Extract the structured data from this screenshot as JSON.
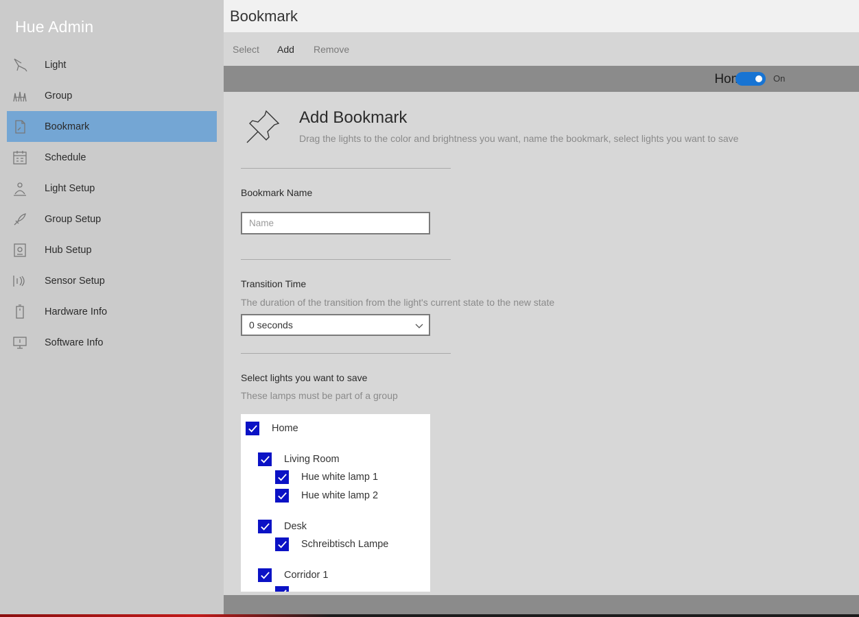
{
  "app": {
    "title": "Hue Admin"
  },
  "sidebar": {
    "active": "Bookmark",
    "items": [
      {
        "label": "Light",
        "icon": "lamp-icon"
      },
      {
        "label": "Group",
        "icon": "group-lamps-icon"
      },
      {
        "label": "Bookmark",
        "icon": "bookmark-document-icon"
      },
      {
        "label": "Schedule",
        "icon": "calendar-icon"
      },
      {
        "label": "Light Setup",
        "icon": "light-setup-icon"
      },
      {
        "label": "Group Setup",
        "icon": "group-setup-icon"
      },
      {
        "label": "Hub Setup",
        "icon": "hub-icon"
      },
      {
        "label": "Sensor Setup",
        "icon": "sensor-icon"
      },
      {
        "label": "Hardware Info",
        "icon": "hardware-icon"
      },
      {
        "label": "Software Info",
        "icon": "monitor-icon"
      }
    ]
  },
  "page": {
    "title": "Bookmark"
  },
  "commands": {
    "select": "Select",
    "add": "Add",
    "remove": "Remove"
  },
  "home_bar": {
    "label": "Home",
    "toggle_state": "On",
    "toggle_on": true,
    "accent": "#1874d3"
  },
  "form": {
    "heading": "Add Bookmark",
    "description": "Drag the lights to the color and brightness you want, name the bookmark, select lights you want to save",
    "name": {
      "label": "Bookmark Name",
      "placeholder": "Name",
      "value": ""
    },
    "transition": {
      "label": "Transition Time",
      "hint": "The duration of the transition from the light's current state to the new state",
      "selected": "0 seconds"
    },
    "lights": {
      "label": "Select lights you want to save",
      "hint": "These lamps must be part of a group",
      "tree": [
        {
          "label": "Home",
          "level": 0,
          "checked": true
        },
        {
          "label": "Living Room",
          "level": 1,
          "checked": true
        },
        {
          "label": "Hue white lamp 1",
          "level": 2,
          "checked": true
        },
        {
          "label": "Hue white lamp 2",
          "level": 2,
          "checked": true
        },
        {
          "label": "Desk",
          "level": 1,
          "checked": true
        },
        {
          "label": "Schreibtisch Lampe",
          "level": 2,
          "checked": true
        },
        {
          "label": "Corridor 1",
          "level": 1,
          "checked": true
        }
      ]
    }
  },
  "colors": {
    "active_nav": "#74a6d4",
    "checkbox": "#0b12c5"
  }
}
